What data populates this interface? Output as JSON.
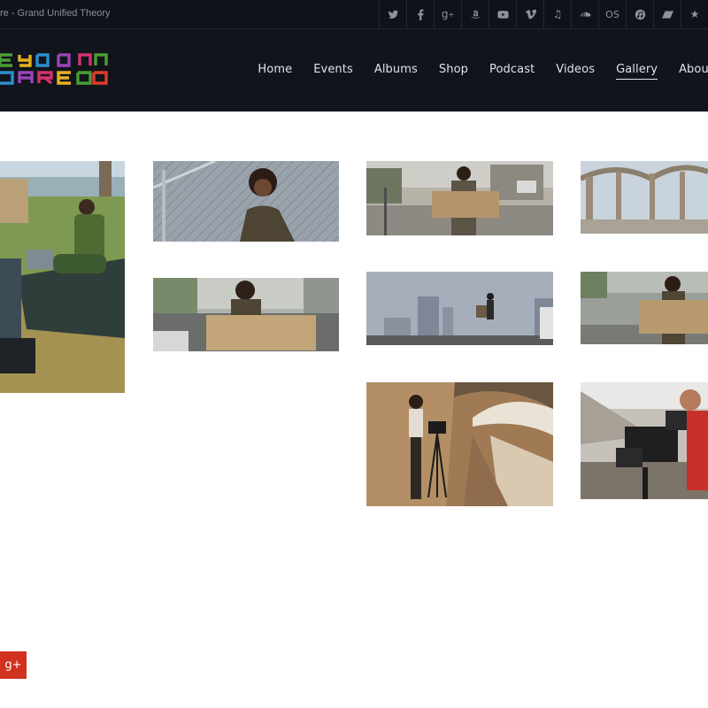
{
  "topbar": {
    "now_playing": "re - Grand Unified Theory",
    "social_icons": [
      "twitter-icon",
      "facebook-icon",
      "google-plus-icon",
      "amazon-icon",
      "youtube-icon",
      "vimeo-icon",
      "music-note-icon",
      "soundcloud-icon",
      "lastfm-icon",
      "itunes-icon",
      "bandcamp-icon",
      "star-icon"
    ]
  },
  "header": {
    "logo_lines": [
      "EYDON",
      "JARED"
    ],
    "nav": [
      {
        "label": "Home",
        "active": false
      },
      {
        "label": "Events",
        "active": false
      },
      {
        "label": "Albums",
        "active": false
      },
      {
        "label": "Shop",
        "active": false
      },
      {
        "label": "Podcast",
        "active": false
      },
      {
        "label": "Videos",
        "active": false
      },
      {
        "label": "Gallery",
        "active": true
      },
      {
        "label": "About",
        "active": false
      }
    ]
  },
  "gallery": {
    "photos": [
      {
        "id": 1,
        "subject": "Crew filming man reading on tarp in park"
      },
      {
        "id": 2,
        "subject": "Man standing by chain-link fence"
      },
      {
        "id": 3,
        "subject": "Man holding cardboard sign on street"
      },
      {
        "id": 4,
        "subject": "Bridge arches over river"
      },
      {
        "id": 5,
        "subject": "Man with cardboard sign on overpass"
      },
      {
        "id": 6,
        "subject": "Man pushing cart across bridge with skyline"
      },
      {
        "id": 7,
        "subject": "Man with sign by fence"
      },
      {
        "id": 8,
        "subject": "Camera operator in concrete river channel"
      },
      {
        "id": 9,
        "subject": "Cameraman with rig under bridge"
      }
    ]
  },
  "floating_share": {
    "icon": "google-plus-icon",
    "label": "g+"
  },
  "colors": {
    "topbar_bg": "#0f1218",
    "header_bg": "#11141b",
    "accent_share": "#d0321f"
  }
}
